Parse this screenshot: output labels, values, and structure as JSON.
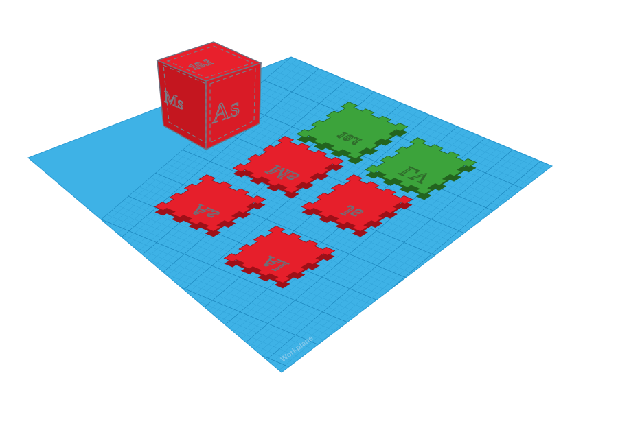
{
  "workplane": {
    "watermark": "Workplane",
    "colors": {
      "grid_fill": "#3eb2e6",
      "grid_line": "#1f8fc7",
      "grid_major": "#127ab2"
    }
  },
  "cube": {
    "label_top": "10.f",
    "label_left": "Ms",
    "label_right": "As",
    "colors": {
      "top": "#e8202c",
      "left": "#c4161f",
      "right": "#d91b26",
      "edge": "#6f7180"
    }
  },
  "tiles": [
    {
      "id": "as",
      "label": "As",
      "color": "red"
    },
    {
      "id": "ms",
      "label": "Ms",
      "color": "red"
    },
    {
      "id": "al",
      "label": "Al",
      "color": "red"
    },
    {
      "id": "js",
      "label": "Js",
      "color": "red"
    },
    {
      "id": "fo",
      "label": "10.f",
      "color": "green"
    },
    {
      "id": "lv",
      "label": "LV",
      "color": "green"
    }
  ],
  "colors": {
    "red_top": "#e61f2b",
    "red_side": "#9e1018",
    "green_top": "#3ca33b",
    "green_side": "#23641f"
  }
}
